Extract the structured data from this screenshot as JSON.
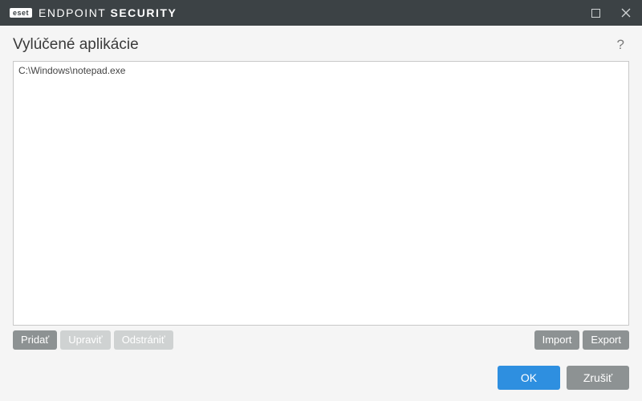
{
  "titlebar": {
    "logo_text": "eset",
    "product_name_light": "ENDPOINT ",
    "product_name_bold": "SECURITY"
  },
  "header": {
    "title": "Vylúčené aplikácie",
    "help_glyph": "?"
  },
  "list": {
    "items": [
      "C:\\Windows\\notepad.exe"
    ]
  },
  "actions": {
    "add": "Pridať",
    "edit": "Upraviť",
    "delete": "Odstrániť",
    "import": "Import",
    "export": "Export"
  },
  "footer": {
    "ok": "OK",
    "cancel": "Zrušiť"
  }
}
